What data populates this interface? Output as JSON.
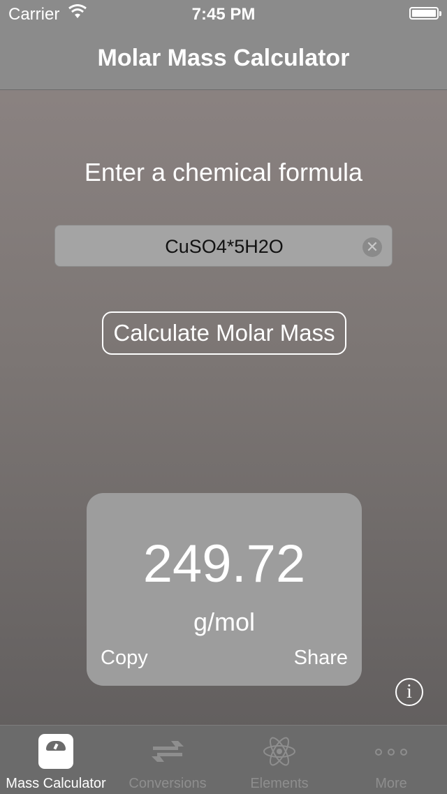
{
  "status_bar": {
    "carrier": "Carrier",
    "time": "7:45 PM"
  },
  "nav": {
    "title": "Molar Mass Calculator"
  },
  "main": {
    "prompt": "Enter a chemical formula",
    "formula_value": "CuSO4*5H2O",
    "calculate_label": "Calculate Molar Mass"
  },
  "result": {
    "value": "249.72",
    "unit": "g/mol",
    "copy_label": "Copy",
    "share_label": "Share"
  },
  "tabs": [
    {
      "label": "Mass Calculator",
      "icon": "scale-icon",
      "active": true
    },
    {
      "label": "Conversions",
      "icon": "swap-arrows-icon",
      "active": false
    },
    {
      "label": "Elements",
      "icon": "atom-icon",
      "active": false
    },
    {
      "label": "More",
      "icon": "more-dots-icon",
      "active": false
    }
  ],
  "colors": {
    "nav_bg": "#8b8b8b",
    "tab_bar_bg": "#6b6b6b",
    "card_bg": "#9d9d9d"
  }
}
